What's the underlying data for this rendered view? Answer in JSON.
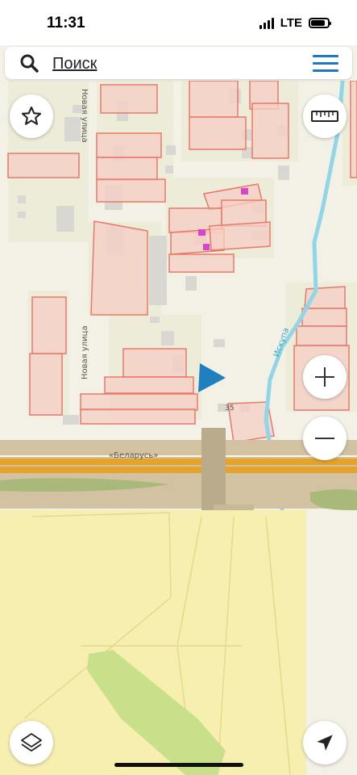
{
  "status_bar": {
    "time": "11:31",
    "network": "LTE",
    "battery_level": 0.85
  },
  "search": {
    "label": "Поиск"
  },
  "map": {
    "street_labels": {
      "novaya_1": "Новая улица",
      "novaya_2": "Новая улица",
      "highway": "«Беларусь»",
      "river": "Искупа",
      "house_number": "35"
    },
    "colors": {
      "parcel_fill": "#f6cfc4",
      "parcel_stroke": "#e9786a",
      "road": "#d9a24a",
      "river": "#8fd6e8",
      "field": "#f7efb0",
      "location_marker": "#1f7fbf"
    }
  },
  "controls": {
    "favorite_icon": "star-icon",
    "ruler_icon": "ruler-icon",
    "zoom_in_icon": "plus-icon",
    "zoom_out_icon": "minus-icon",
    "layers_icon": "layers-icon",
    "locate_icon": "navigation-arrow-icon"
  }
}
